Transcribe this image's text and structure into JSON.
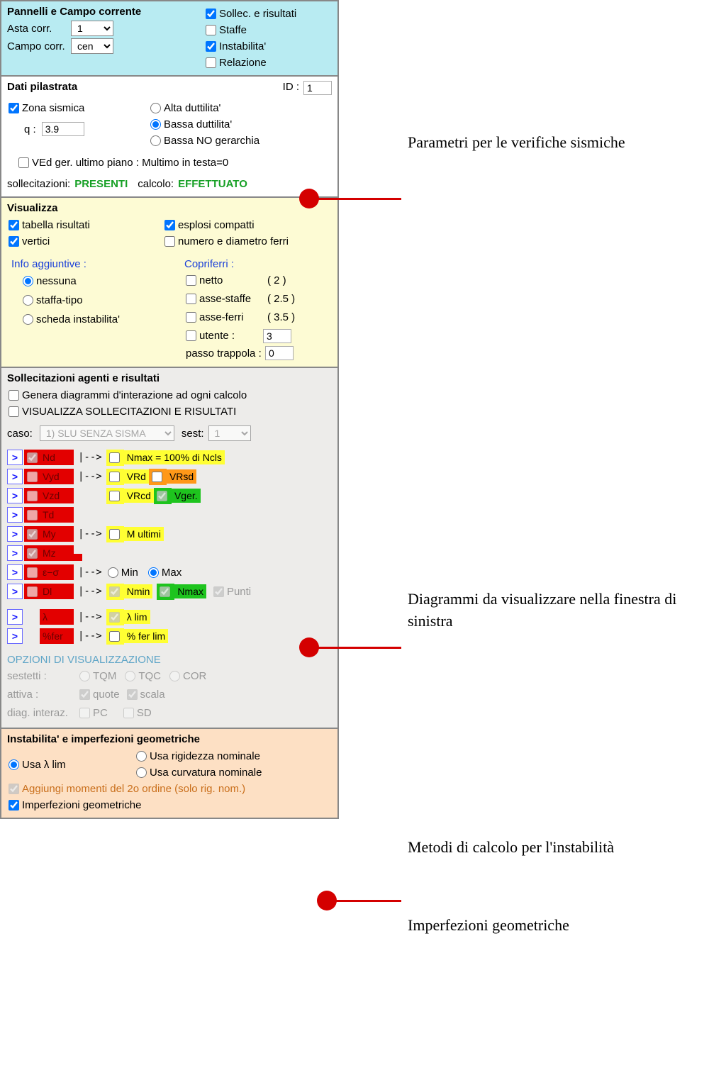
{
  "pannelli": {
    "title": "Pannelli e Campo corrente",
    "asta_label": "Asta corr.",
    "asta_value": "1",
    "campo_label": "Campo corr.",
    "campo_value": "cen",
    "checks": [
      {
        "label": "Sollec. e risultati",
        "checked": true
      },
      {
        "label": "Staffe",
        "checked": false
      },
      {
        "label": "Instabilita'",
        "checked": true
      },
      {
        "label": "Relazione",
        "checked": false
      }
    ]
  },
  "dati": {
    "title": "Dati pilastrata",
    "id_label": "ID :",
    "id_value": "1",
    "zona_label": "Zona sismica",
    "q_label": "q :",
    "q_value": "3.9",
    "radio_alta": "Alta duttilita'",
    "radio_bassa": "Bassa duttilita'",
    "radio_bassa_no": "Bassa NO gerarchia",
    "ved_label": "VEd ger. ultimo piano : Multimo in testa=0",
    "sollec_label": "sollecitazioni:",
    "sollec_value": "PRESENTI",
    "calcolo_label": "calcolo:",
    "calcolo_value": "EFFETTUATO"
  },
  "visualizza": {
    "title": "Visualizza",
    "tab_risultati": "tabella risultati",
    "vertici": "vertici",
    "esplosi": "esplosi compatti",
    "numero_diam": "numero e diametro ferri",
    "info_title": "Info aggiuntive :",
    "info_nessuna": "nessuna",
    "info_staffa": "staffa-tipo",
    "info_scheda": "scheda instabilita'",
    "copri_title": "Copriferri :",
    "netto": "netto",
    "netto_val": "( 2 )",
    "asse_staffe": "asse-staffe",
    "asse_staffe_val": "( 2.5 )",
    "asse_ferri": "asse-ferri",
    "asse_ferri_val": "( 3.5 )",
    "utente": "utente  :",
    "utente_val": "3",
    "passo": "passo trappola :",
    "passo_val": "0"
  },
  "sollec": {
    "title": "Sollecitazioni agenti e risultati",
    "genera": "Genera diagrammi d'interazione ad ogni calcolo",
    "visualizza_cap": "VISUALIZZA SOLLECITAZIONI E RISULTATI",
    "caso_label": "caso:",
    "caso_value": "1) SLU SENZA SISMA",
    "sest_label": "sest:",
    "sest_value": "1",
    "rows": {
      "nd": "Nd",
      "vyd": "Vyd",
      "vzd": "Vzd",
      "td": "Td",
      "my": "My",
      "mz": "Mz",
      "eps": "ε−σ",
      "dl": "Dl",
      "lambda": "λ",
      "pfer": "%fer"
    },
    "nmax": "Nmax = 100% di Ncls",
    "vrd": "VRd",
    "vrsd": "VRsd",
    "vrcd": "VRcd",
    "vger": "Vger.",
    "multimi": "M ultimi",
    "min": "Min",
    "max": "Max",
    "nmin": "Nmin",
    "nmax2": "Nmax",
    "punti": "Punti",
    "llim": "λ lim",
    "pferlim": "% fer lim",
    "opzioni": "OPZIONI DI VISUALIZZAZIONE",
    "sestetti": "sestetti :",
    "tqm": "TQM",
    "tqc": "TQC",
    "cor": "COR",
    "attiva": "attiva :",
    "quote": "quote",
    "scala": "scala",
    "diag_interaz": "diag. interaz.",
    "pc": "PC",
    "sd": "SD"
  },
  "instab": {
    "title": "Instabilita' e imperfezioni geometriche",
    "usa_llim": "Usa  λ  lim",
    "usa_rig": "Usa rigidezza nominale",
    "usa_curv": "Usa curvatura nominale",
    "aggiungi": "Aggiungi momenti del 2o ordine (solo rig. nom.)",
    "imperfezioni": "Imperfezioni geometriche"
  },
  "annotations": {
    "a1": "Parametri per le verifiche sismiche",
    "a2": "Diagrammi da visualizzare nella finestra di sinistra",
    "a3": "Metodi di calcolo per l'instabilità",
    "a4": "Imperfezioni geometriche"
  }
}
